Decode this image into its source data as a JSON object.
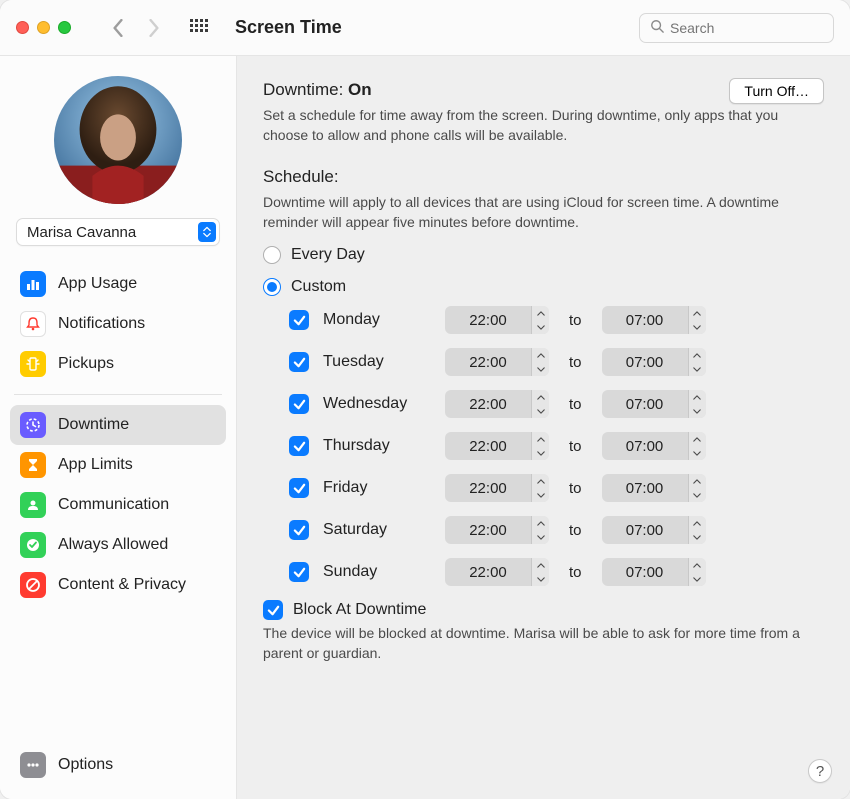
{
  "window": {
    "title": "Screen Time"
  },
  "search": {
    "placeholder": "Search"
  },
  "user": {
    "name": "Marisa Cavanna"
  },
  "sidebar": {
    "usage": [
      {
        "label": "App Usage",
        "icon": "bar-chart-icon",
        "bg": "#0a7bff"
      },
      {
        "label": "Notifications",
        "icon": "bell-icon",
        "bg": "#ffffff"
      },
      {
        "label": "Pickups",
        "icon": "phone-pickup-icon",
        "bg": "#ffcc00"
      }
    ],
    "limits": [
      {
        "label": "Downtime",
        "icon": "clock-icon",
        "bg": "#6a5cff",
        "active": true
      },
      {
        "label": "App Limits",
        "icon": "hourglass-icon",
        "bg": "#ff9500"
      },
      {
        "label": "Communication",
        "icon": "person-bubble-icon",
        "bg": "#32d158"
      },
      {
        "label": "Always Allowed",
        "icon": "check-badge-icon",
        "bg": "#32d158"
      },
      {
        "label": "Content & Privacy",
        "icon": "no-entry-icon",
        "bg": "#ff3b30"
      }
    ],
    "options": {
      "label": "Options",
      "icon": "ellipsis-icon",
      "bg": "#8e8e93"
    }
  },
  "main": {
    "downtime_label": "Downtime:",
    "downtime_state": "On",
    "turn_off": "Turn Off…",
    "downtime_desc": "Set a schedule for time away from the screen. During downtime, only apps that you choose to allow and phone calls will be available.",
    "schedule_label": "Schedule:",
    "schedule_desc": "Downtime will apply to all devices that are using iCloud for screen time. A downtime reminder will appear five minutes before downtime.",
    "every_day": "Every Day",
    "custom": "Custom",
    "schedule_mode": "custom",
    "to_label": "to",
    "days": [
      {
        "name": "Monday",
        "checked": true,
        "from": "22:00",
        "to": "07:00"
      },
      {
        "name": "Tuesday",
        "checked": true,
        "from": "22:00",
        "to": "07:00"
      },
      {
        "name": "Wednesday",
        "checked": true,
        "from": "22:00",
        "to": "07:00"
      },
      {
        "name": "Thursday",
        "checked": true,
        "from": "22:00",
        "to": "07:00"
      },
      {
        "name": "Friday",
        "checked": true,
        "from": "22:00",
        "to": "07:00"
      },
      {
        "name": "Saturday",
        "checked": true,
        "from": "22:00",
        "to": "07:00"
      },
      {
        "name": "Sunday",
        "checked": true,
        "from": "22:00",
        "to": "07:00"
      }
    ],
    "block_label": "Block At Downtime",
    "block_checked": true,
    "block_desc": "The device will be blocked at downtime. Marisa will be able to ask for more time from a parent or guardian."
  },
  "help": "?"
}
